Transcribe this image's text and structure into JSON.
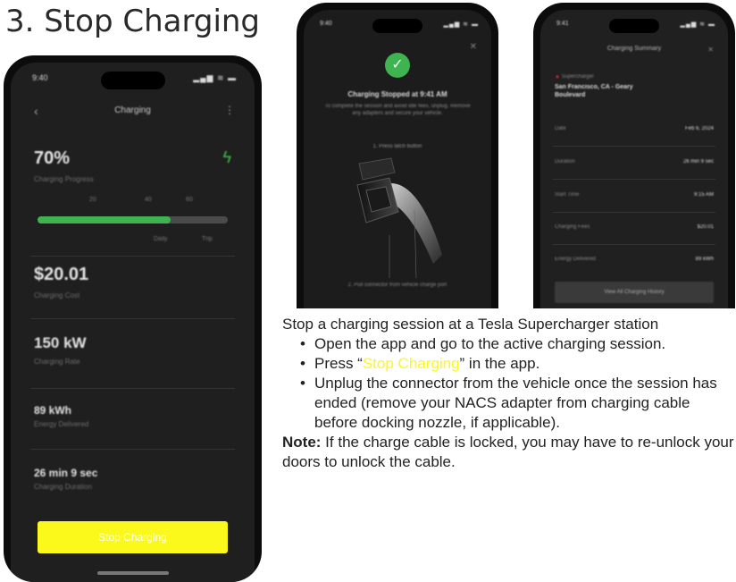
{
  "heading": "3. Stop Charging",
  "phone1": {
    "time": "9:40",
    "status_icons": "▂▄▆ ≋ ▬",
    "nav_title": "Charging",
    "progress_pct": "70%",
    "progress_label": "Charging Progress",
    "progress_fraction": 0.7,
    "tick_labels": [
      "20",
      "40",
      "60"
    ],
    "bar_labels": [
      "Daily",
      "Trip"
    ],
    "cost": "$20.01",
    "cost_label": "Charging Cost",
    "rate": "150 kW",
    "rate_label": "Charging Rate",
    "energy": "89 kWh",
    "energy_label": "Energy Delivered",
    "duration": "26 min 9 sec",
    "duration_label": "Charging Duration",
    "stop_button": "Stop Charging",
    "colors": {
      "accent_green": "#3fb34f",
      "stop_yellow": "#fbf91b"
    }
  },
  "phone2": {
    "time": "9:40",
    "status_icons": "▂▄▆ ≋ ▬",
    "stopped_title": "Charging Stopped at 9:41 AM",
    "stopped_desc": "To complete the session and avoid idle fees, unplug. Remove any adapters and secure your vehicle.",
    "caption_top": "1. Press latch button",
    "caption_bottom": "2. Pull connector from vehicle charge port"
  },
  "phone3": {
    "time": "9:41",
    "status_icons": "▂▄▆ ≋ ▬",
    "title": "Charging Summary",
    "loc_label": "Supercharger",
    "loc_name": "San Francisco, CA - Geary Boulevard",
    "rows": [
      {
        "k": "Date",
        "v": "Feb 6, 2024"
      },
      {
        "k": "Duration",
        "v": "26 min 9 sec"
      },
      {
        "k": "Start Time",
        "v": "9:15 AM"
      },
      {
        "k": "Charging Fees",
        "v": "$20.01"
      },
      {
        "k": "Energy Delivered",
        "v": "89 kWh"
      }
    ],
    "history_button": "View All Charging History"
  },
  "instructions": {
    "intro": "Stop a charging session at a Tesla Supercharger station",
    "bullet1": "Open the app and go to the active charging session.",
    "bullet2_pre": "Press “",
    "bullet2_hl": "Stop Charging",
    "bullet2_post": "” in the app.",
    "bullet3": "Unplug the connector from the vehicle once the session has ended (remove your NACS adapter from charging cable before docking nozzle, if applicable).",
    "note_label": "Note:",
    "note_text": " If the charge cable is locked, you may have to re-unlock your doors to unlock the cable."
  }
}
